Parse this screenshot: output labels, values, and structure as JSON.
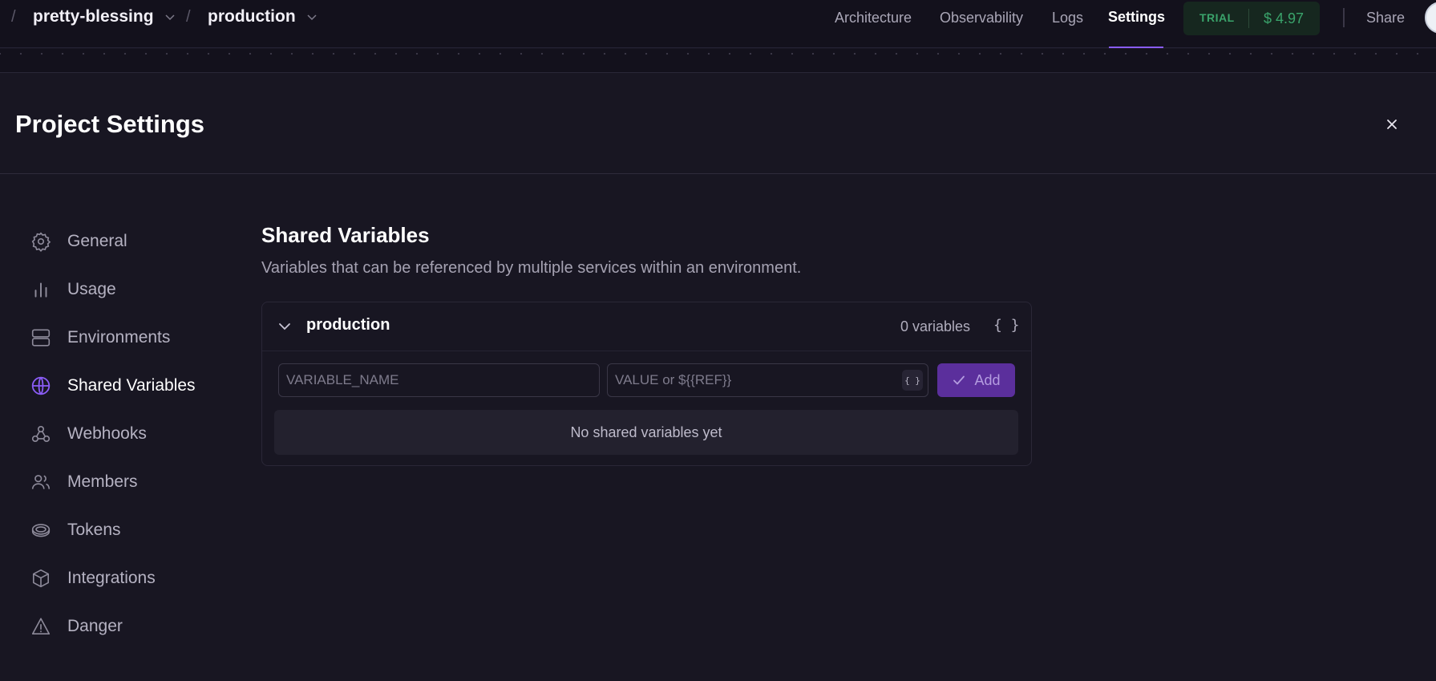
{
  "breadcrumb": {
    "sep": "/",
    "project": "pretty-blessing",
    "environment": "production"
  },
  "nav": {
    "architecture": "Architecture",
    "observability": "Observability",
    "logs": "Logs",
    "settings": "Settings",
    "trial_label": "TRIAL",
    "trial_amount": "$ 4.97",
    "share": "Share"
  },
  "header": {
    "title": "Project Settings"
  },
  "sidebar": {
    "items": [
      {
        "label": "General",
        "icon": "gear-icon"
      },
      {
        "label": "Usage",
        "icon": "bar-chart-icon"
      },
      {
        "label": "Environments",
        "icon": "server-icon"
      },
      {
        "label": "Shared Variables",
        "icon": "globe-icon"
      },
      {
        "label": "Webhooks",
        "icon": "webhook-icon"
      },
      {
        "label": "Members",
        "icon": "users-icon"
      },
      {
        "label": "Tokens",
        "icon": "token-icon"
      },
      {
        "label": "Integrations",
        "icon": "box-icon"
      },
      {
        "label": "Danger",
        "icon": "warning-icon"
      }
    ],
    "active_index": 3
  },
  "main": {
    "title": "Shared Variables",
    "description": "Variables that can be referenced by multiple services within an environment.",
    "card": {
      "environment": "production",
      "count": "0 variables",
      "raw_editor": "{ }",
      "name_placeholder": "VARIABLE_NAME",
      "value_placeholder": "VALUE or ${{REF}}",
      "ref_button": "{ }",
      "add_label": "Add",
      "empty_text": "No shared variables yet"
    }
  },
  "colors": {
    "background": "#181622",
    "accent": "#8a5cf5",
    "trial_green": "#3aa36b",
    "add_button": "#5b2f9c"
  }
}
